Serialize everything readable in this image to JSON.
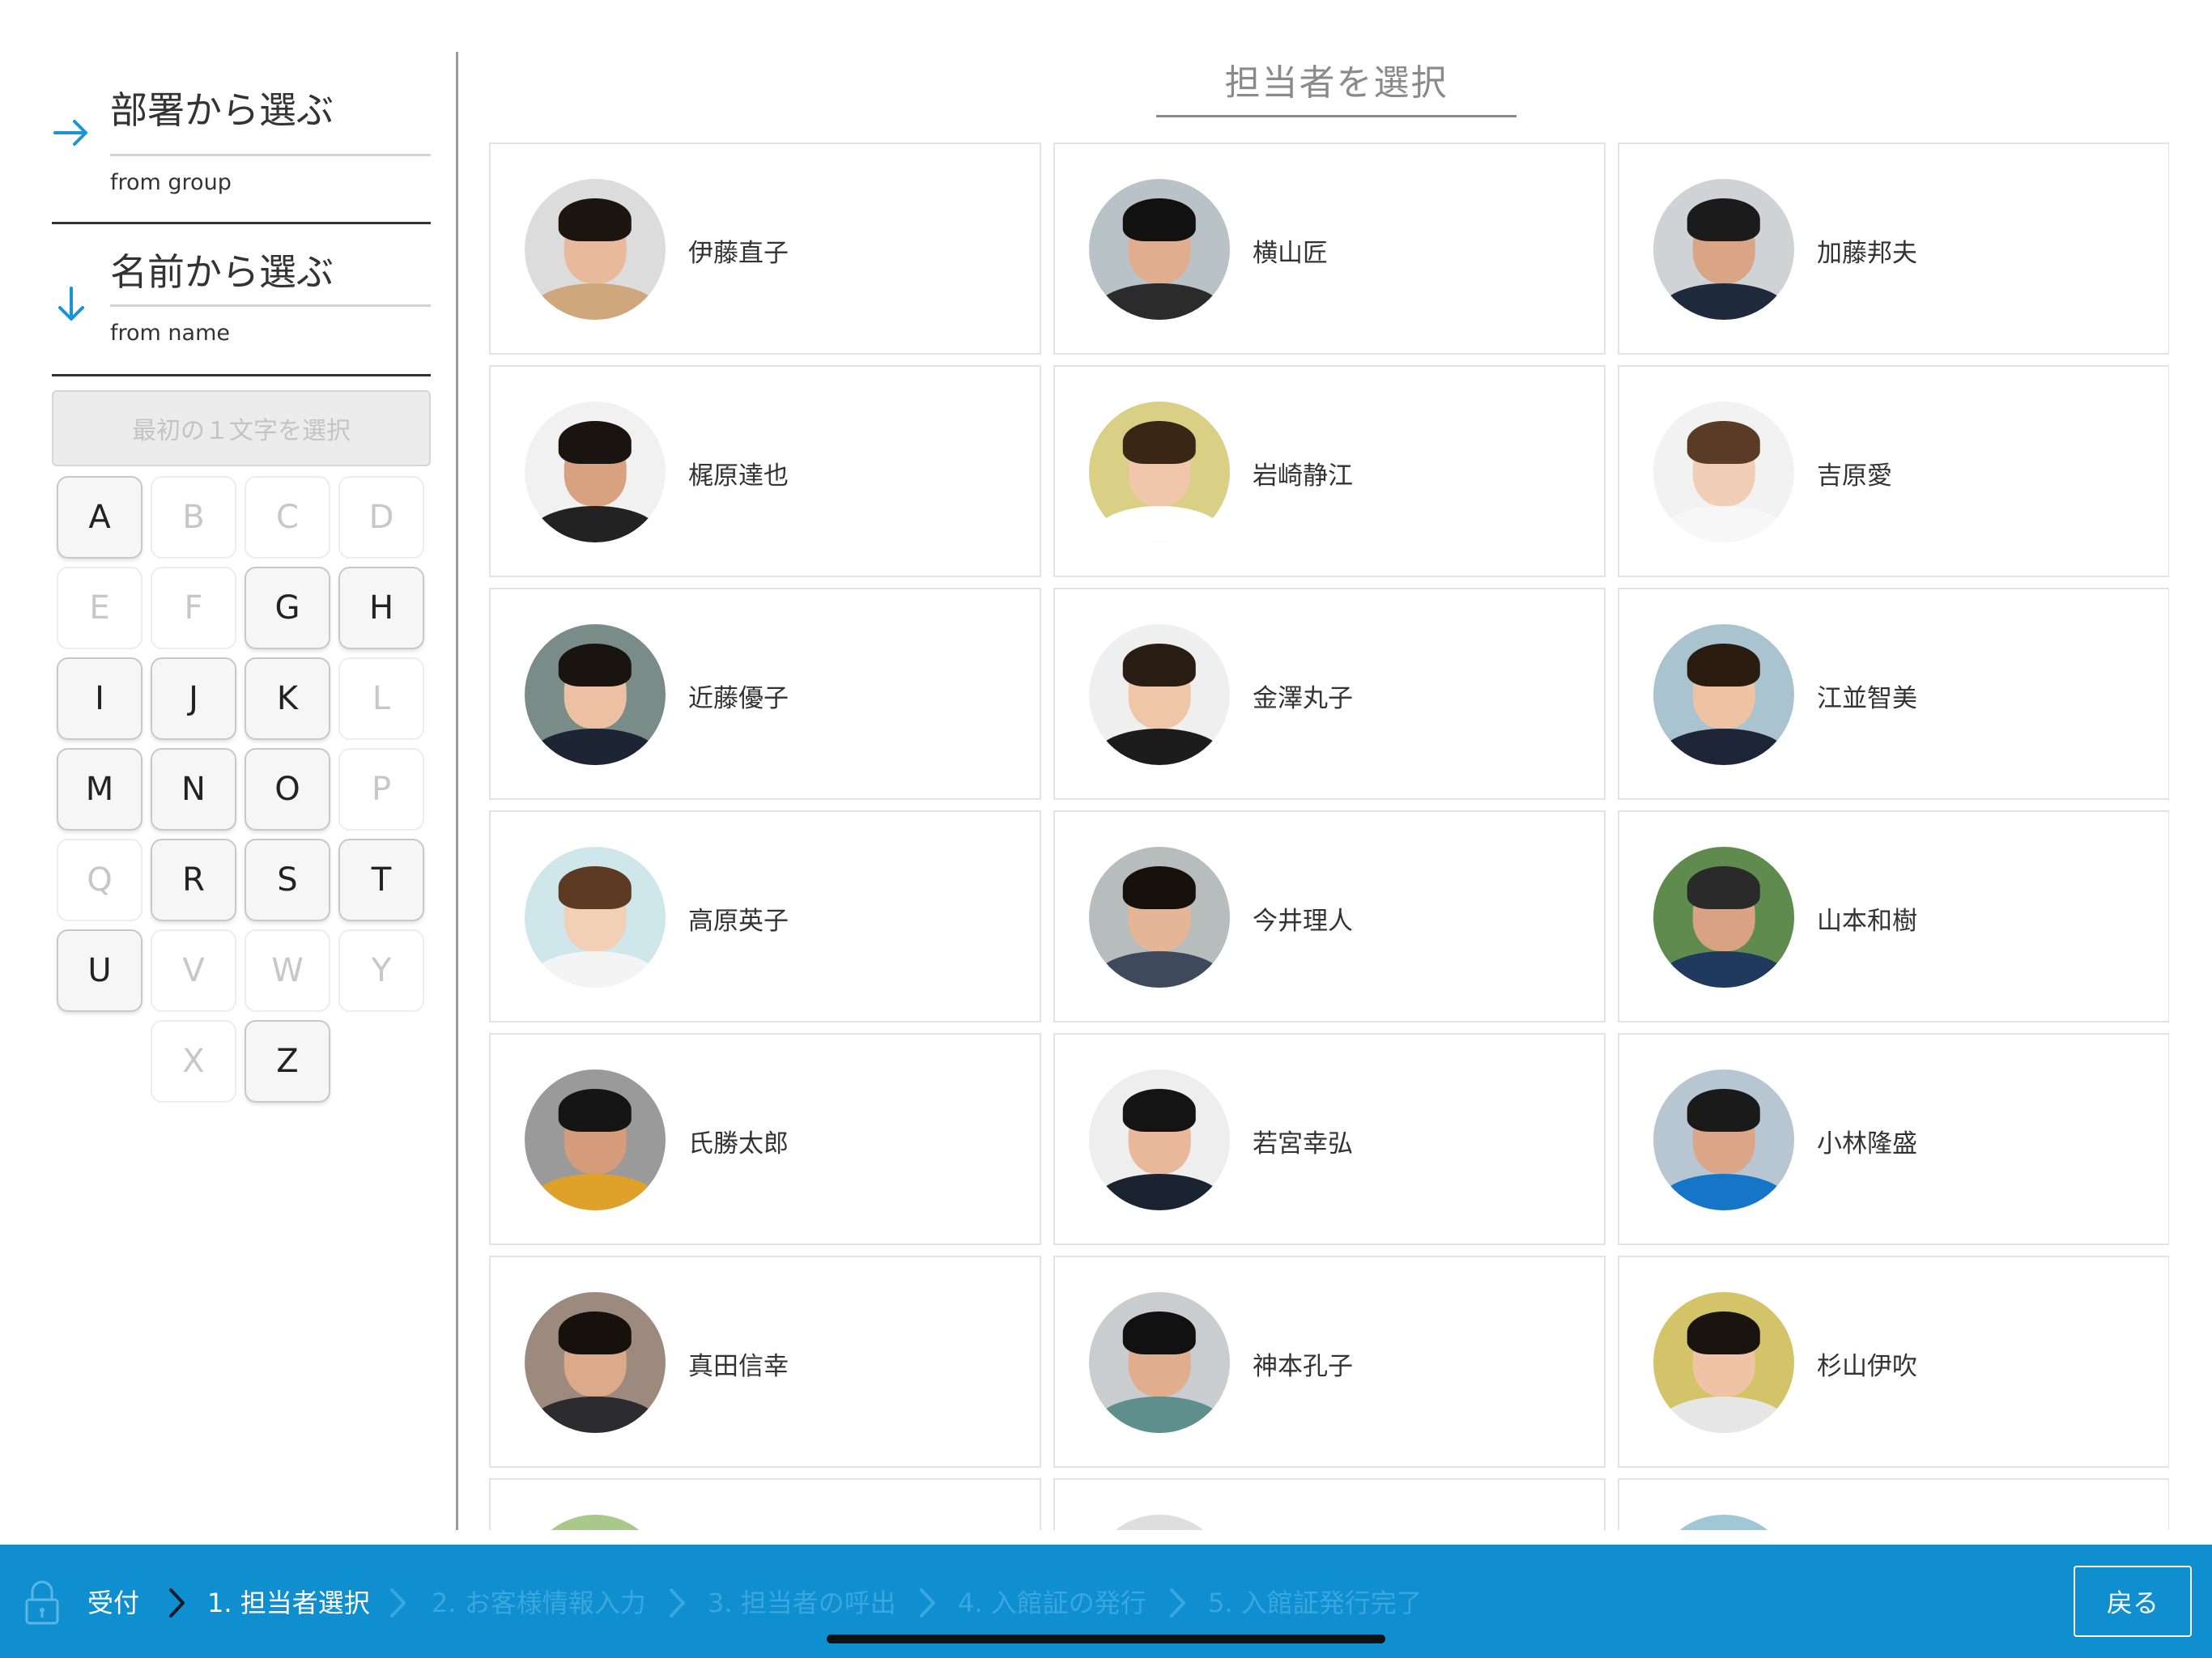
{
  "sidebar": {
    "group_mode": {
      "title": "部署から選ぶ",
      "subtitle": "from group"
    },
    "name_mode": {
      "title": "名前から選ぶ",
      "subtitle": "from name"
    },
    "letter_hint": "最初の１文字を選択",
    "keys": [
      {
        "label": "A",
        "enabled": true
      },
      {
        "label": "B",
        "enabled": false
      },
      {
        "label": "C",
        "enabled": false
      },
      {
        "label": "D",
        "enabled": false
      },
      {
        "label": "E",
        "enabled": false
      },
      {
        "label": "F",
        "enabled": false
      },
      {
        "label": "G",
        "enabled": true
      },
      {
        "label": "H",
        "enabled": true
      },
      {
        "label": "I",
        "enabled": true
      },
      {
        "label": "J",
        "enabled": true
      },
      {
        "label": "K",
        "enabled": true
      },
      {
        "label": "L",
        "enabled": false
      },
      {
        "label": "M",
        "enabled": true
      },
      {
        "label": "N",
        "enabled": true
      },
      {
        "label": "O",
        "enabled": true
      },
      {
        "label": "P",
        "enabled": false
      },
      {
        "label": "Q",
        "enabled": false
      },
      {
        "label": "R",
        "enabled": true
      },
      {
        "label": "S",
        "enabled": true
      },
      {
        "label": "T",
        "enabled": true
      },
      {
        "label": "U",
        "enabled": true
      },
      {
        "label": "V",
        "enabled": false
      },
      {
        "label": "W",
        "enabled": false
      },
      {
        "label": "Y",
        "enabled": false
      },
      {
        "label": "X",
        "enabled": false
      },
      {
        "label": "Z",
        "enabled": true
      }
    ]
  },
  "main": {
    "title": "担当者を選択",
    "people": [
      {
        "name": "伊藤直子",
        "avatar": {
          "bg": "#dcdcdc",
          "skin": "#e8b99a",
          "hair": "#1d1510",
          "top": "#cfa77d"
        }
      },
      {
        "name": "横山匠",
        "avatar": {
          "bg": "#b9c2c6",
          "skin": "#e0ae8e",
          "hair": "#111111",
          "top": "#2b2b2b"
        }
      },
      {
        "name": "加藤邦夫",
        "avatar": {
          "bg": "#cfd3d6",
          "skin": "#d9a584",
          "hair": "#1b1b1b",
          "top": "#1f2a3c"
        }
      },
      {
        "name": "梶原達也",
        "avatar": {
          "bg": "#f1f1f1",
          "skin": "#d8a180",
          "hair": "#1a1410",
          "top": "#222222"
        }
      },
      {
        "name": "岩崎静江",
        "avatar": {
          "bg": "#d9cf85",
          "skin": "#f0c7aa",
          "hair": "#3a2615",
          "top": "#ffffff"
        }
      },
      {
        "name": "吉原愛",
        "avatar": {
          "bg": "#f2f2f2",
          "skin": "#f2cdb6",
          "hair": "#5a3b26",
          "top": "#f7f7f7"
        }
      },
      {
        "name": "近藤優子",
        "avatar": {
          "bg": "#7a8c88",
          "skin": "#ecc0a2",
          "hair": "#1a1410",
          "top": "#1d2433"
        }
      },
      {
        "name": "金澤丸子",
        "avatar": {
          "bg": "#efefef",
          "skin": "#f0c6a8",
          "hair": "#2a1d14",
          "top": "#1c1c1c"
        }
      },
      {
        "name": "江並智美",
        "avatar": {
          "bg": "#a9c3cf",
          "skin": "#eec3a4",
          "hair": "#2b1c12",
          "top": "#1e2536"
        }
      },
      {
        "name": "高原英子",
        "avatar": {
          "bg": "#cfe6ea",
          "skin": "#f2cfb5",
          "hair": "#5c3b22",
          "top": "#f4f4f4"
        }
      },
      {
        "name": "今井理人",
        "avatar": {
          "bg": "#b7bcbc",
          "skin": "#e5b597",
          "hair": "#16110d",
          "top": "#3e4a5c"
        }
      },
      {
        "name": "山本和樹",
        "avatar": {
          "bg": "#5f8c4e",
          "skin": "#d8a283",
          "hair": "#2a2a2a",
          "top": "#1f3a5c"
        }
      },
      {
        "name": "氏勝太郎",
        "avatar": {
          "bg": "#9a9a9a",
          "skin": "#d49c7a",
          "hair": "#151515",
          "top": "#e0a12a"
        }
      },
      {
        "name": "若宮幸弘",
        "avatar": {
          "bg": "#eeeeee",
          "skin": "#e9b89a",
          "hair": "#141414",
          "top": "#1b2230"
        }
      },
      {
        "name": "小林隆盛",
        "avatar": {
          "bg": "#b8c6d2",
          "skin": "#dba687",
          "hair": "#1a1a1a",
          "top": "#1576c8"
        }
      },
      {
        "name": "真田信幸",
        "avatar": {
          "bg": "#9c8a7e",
          "skin": "#dcaa8a",
          "hair": "#16110d",
          "top": "#2b2b30"
        }
      },
      {
        "name": "神本孔子",
        "avatar": {
          "bg": "#c9cdd0",
          "skin": "#e0ad8d",
          "hair": "#111111",
          "top": "#5e8f8c"
        }
      },
      {
        "name": "杉山伊吹",
        "avatar": {
          "bg": "#d3c46a",
          "skin": "#efc4a6",
          "hair": "#1a1410",
          "top": "#e6e6e6"
        }
      },
      {
        "name": "",
        "avatar": {
          "bg": "#a9c98a",
          "skin": "#e8c0a2",
          "hair": "#3a2a1c",
          "top": "#dddddd"
        }
      },
      {
        "name": "",
        "avatar": {
          "bg": "#dedede",
          "skin": "#e8c0a2",
          "hair": "#2a1d14",
          "top": "#dddddd"
        }
      },
      {
        "name": "",
        "avatar": {
          "bg": "#9fc7d6",
          "skin": "#e8c0a2",
          "hair": "#2a1d14",
          "top": "#dddddd"
        }
      }
    ]
  },
  "footer": {
    "steps": [
      {
        "label": "受付",
        "state": "done"
      },
      {
        "label": "1. 担当者選択",
        "state": "current"
      },
      {
        "label": "2. お客様情報入力",
        "state": "todo"
      },
      {
        "label": "3. 担当者の呼出",
        "state": "todo"
      },
      {
        "label": "4. 入館証の発行",
        "state": "todo"
      },
      {
        "label": "5. 入館証発行完了",
        "state": "todo"
      }
    ],
    "back_label": "戻る",
    "colors": {
      "bar": "#0f8ed0",
      "inactive_step": "#3aa7de"
    }
  }
}
